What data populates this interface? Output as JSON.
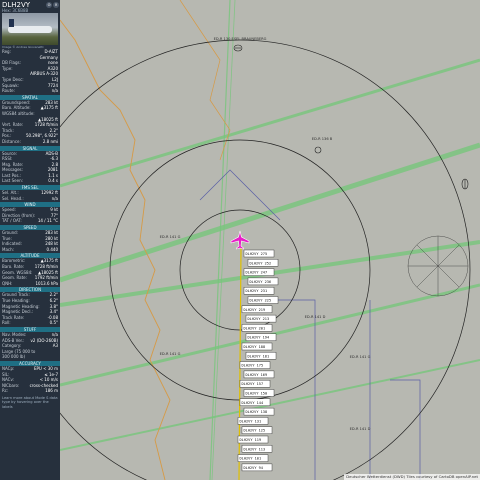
{
  "aircraft": {
    "callsign": "DLH2VY",
    "hex": "Hex: 3C6B8B",
    "photo_credit": "Image © Andrea Giovanetti"
  },
  "info_rows": [
    {
      "k": "Reg:",
      "v": "D-AIZT"
    },
    {
      "k": "",
      "v": "Germany"
    },
    {
      "k": "DB Flags:",
      "v": "none"
    },
    {
      "k": "Type:",
      "v": "A320"
    },
    {
      "k": "",
      "v": "AIRBUS A-320"
    },
    {
      "k": "Type Desc:",
      "v": "L2J"
    },
    {
      "k": "Squawk:",
      "v": "7724"
    },
    {
      "k": "Route:",
      "v": "n/a"
    }
  ],
  "sections": [
    {
      "title": "SPATIAL",
      "rows": [
        {
          "k": "Groundspeed:",
          "v": "283 kt"
        },
        {
          "k": "Baro. Altitude:",
          "v": "▲3175 ft"
        },
        {
          "k": "WGS84 altitude:",
          "v": ""
        },
        {
          "k": "",
          "v": "▲18025 ft"
        },
        {
          "k": "Vert. Rate:",
          "v": "1728 ft/min"
        },
        {
          "k": "Track:",
          "v": "2.2°"
        },
        {
          "k": "Pos.:",
          "v": "50.298°, 6.922°"
        },
        {
          "k": "Distance:",
          "v": "2.8 nmi"
        }
      ]
    },
    {
      "title": "SIGNAL",
      "rows": [
        {
          "k": "Source:",
          "v": "ADS-B"
        },
        {
          "k": "RSSI:",
          "v": "-6.3"
        },
        {
          "k": "Msg. Rate:",
          "v": "2.8"
        },
        {
          "k": "Messages:",
          "v": "2081"
        },
        {
          "k": "Last Pos.:",
          "v": "1.1 s"
        },
        {
          "k": "Last Seen:",
          "v": "0.4 s"
        }
      ]
    },
    {
      "title": "FMS SEL",
      "rows": [
        {
          "k": "Sel. Alt.:",
          "v": "12992 ft"
        },
        {
          "k": "Sel. Head.:",
          "v": "n/a"
        }
      ]
    },
    {
      "title": "WIND",
      "rows": [
        {
          "k": "Speed:",
          "v": "9 kt"
        },
        {
          "k": "Direction (from):",
          "v": "77°"
        },
        {
          "k": "TAT / OAT:",
          "v": "14 / 11 °C"
        }
      ]
    },
    {
      "title": "SPEED",
      "rows": [
        {
          "k": "Ground:",
          "v": "283 kt"
        },
        {
          "k": "True:",
          "v": "280 kt"
        },
        {
          "k": "Indicated:",
          "v": "248 kt"
        },
        {
          "k": "Mach:",
          "v": "0.440"
        }
      ]
    },
    {
      "title": "ALTITUDE",
      "rows": [
        {
          "k": "Barometric:",
          "v": "▲3175 ft"
        },
        {
          "k": "Baro. Rate:",
          "v": "1728 ft/min"
        },
        {
          "k": "Geom. WGS84:",
          "v": "▲18025 ft"
        },
        {
          "k": "Geom. Rate:",
          "v": "1792 ft/min"
        },
        {
          "k": "QNH:",
          "v": "1013.6 hPa"
        }
      ]
    },
    {
      "title": "DIRECTION",
      "rows": [
        {
          "k": "Ground Track:",
          "v": "2.2°"
        },
        {
          "k": "True Heading:",
          "v": "6.2°"
        },
        {
          "k": "Magnetic Heading:",
          "v": "3.8°"
        },
        {
          "k": "Magnetic Decl.:",
          "v": "3.4°"
        },
        {
          "k": "Track Rate:",
          "v": "-0.08"
        },
        {
          "k": "Roll:",
          "v": "0.5°"
        }
      ]
    },
    {
      "title": "STUFF",
      "rows": [
        {
          "k": "Nav. Modes:",
          "v": "n/a"
        },
        {
          "k": "ADS-B Ver.:",
          "v": "v2 (DO-260B)"
        },
        {
          "k": "Category:",
          "v": "A3"
        },
        {
          "k": "Large (75 000 to",
          "v": ""
        },
        {
          "k": "300 000 lb)",
          "v": ""
        }
      ]
    },
    {
      "title": "ACCURACY",
      "rows": [
        {
          "k": "NACp:",
          "v": "EPU < 30 m"
        },
        {
          "k": "SIL:",
          "v": "≤ 1e-7"
        },
        {
          "k": "NACv:",
          "v": "< 10 m/s"
        },
        {
          "k": "NICbaro:",
          "v": "cross-checked"
        },
        {
          "k": "Rc:",
          "v": "186 m"
        }
      ]
    }
  ],
  "footer_text": "Learn more about Mode S data type by hovering over the labels",
  "attribution": "Deutscher Wetterdienst (DWD) Tiles courtesy of CartoDB openAIP.net",
  "map_labels": [
    "ED-R 130 ESEL BRAUNEBERG",
    "ED-R 136 B",
    "ED-R 141 G",
    "ED-R 141 G",
    "ED-R 141 G",
    "ED-R 141 D",
    "ED-R 141 D"
  ],
  "track_tags": [
    "DLH2VY 275",
    "DLH2VY 252",
    "DLH2VY 247",
    "DLH2VY 236",
    "DLH2VY 231",
    "DLH2VY 225",
    "DLH2VY 219",
    "DLH2VY 213",
    "DLH2VY 201",
    "DLH2VY 194",
    "DLH2VY 188",
    "DLH2VY 181",
    "DLH2VY 175",
    "DLH2VY 169",
    "DLH2VY 157",
    "DLH2VY 150",
    "DLH2VY 144",
    "DLH2VY 138",
    "DLH2VY 131",
    "DLH2VY 125",
    "DLH2VY 119",
    "DLH2VY 113",
    "DLH2VY 101",
    "DLH2VY 94"
  ],
  "colors": {
    "panel_bg": "#26303d",
    "section_bg": "#1f6f84",
    "map_bg": "#b7b8b1",
    "aircraft": "#e81ec8",
    "airway": "#77c67c"
  },
  "icons": {
    "close": "close-icon",
    "pin": "pin-icon",
    "aircraft": "aircraft-icon"
  }
}
